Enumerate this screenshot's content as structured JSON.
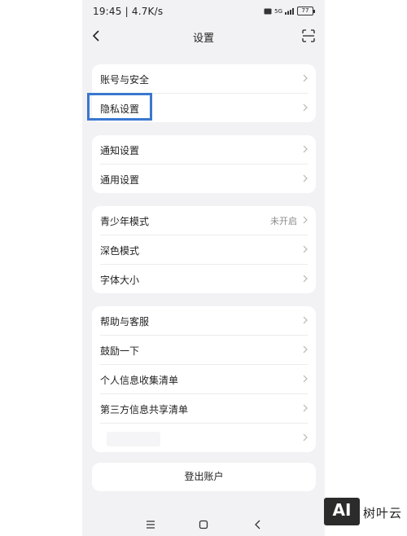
{
  "status_bar": {
    "time_speed": "19:45 | 4.7K/s",
    "battery": "77"
  },
  "header": {
    "title": "设置"
  },
  "groups": [
    {
      "items": [
        {
          "label": "账号与安全"
        },
        {
          "label": "隐私设置"
        }
      ]
    },
    {
      "items": [
        {
          "label": "通知设置"
        },
        {
          "label": "通用设置"
        }
      ]
    },
    {
      "items": [
        {
          "label": "青少年模式",
          "value": "未开启"
        },
        {
          "label": "深色模式"
        },
        {
          "label": "字体大小"
        }
      ]
    },
    {
      "items": [
        {
          "label": "帮助与客服"
        },
        {
          "label": "鼓励一下"
        },
        {
          "label": "个人信息收集清单"
        },
        {
          "label": "第三方信息共享清单"
        },
        {
          "label": ""
        }
      ]
    }
  ],
  "logout_label": "登出账户",
  "watermark": {
    "logo": "AI",
    "text": "树叶云"
  },
  "colors": {
    "highlight": "#3a77d0",
    "background": "#f2f2f4"
  }
}
